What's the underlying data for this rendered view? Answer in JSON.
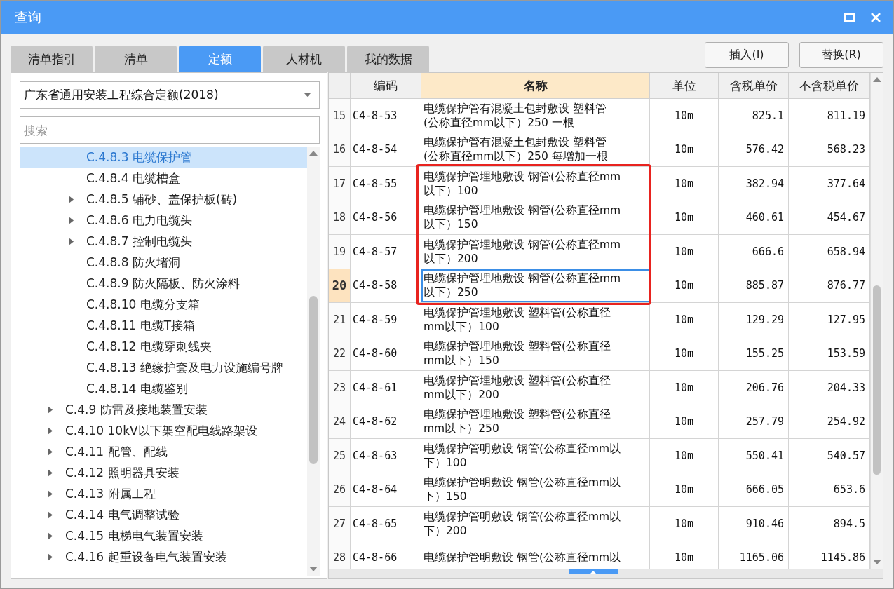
{
  "window": {
    "title": "查询"
  },
  "tabs": [
    {
      "label": "清单指引",
      "selected": false
    },
    {
      "label": "清单",
      "selected": false
    },
    {
      "label": "定额",
      "selected": true
    },
    {
      "label": "人材机",
      "selected": false
    },
    {
      "label": "我的数据",
      "selected": false
    }
  ],
  "buttons": [
    "插入(I)",
    "替换(R)"
  ],
  "library_select": {
    "value": "广东省通用安装工程综合定额(2018)"
  },
  "search": {
    "placeholder": "搜索"
  },
  "tree": {
    "items": [
      {
        "children": [
          {
            "label": "C.4.8.3 电缆保护管",
            "expandable": false,
            "selected": true
          },
          {
            "label": "C.4.8.4 电缆槽盒",
            "expandable": false,
            "selected": false
          },
          {
            "label": "C.4.8.5 铺砂、盖保护板(砖)",
            "expandable": true,
            "selected": false
          },
          {
            "label": "C.4.8.6 电力电缆头",
            "expandable": true,
            "selected": false
          },
          {
            "label": "C.4.8.7 控制电缆头",
            "expandable": true,
            "selected": false
          },
          {
            "label": "C.4.8.8 防火堵洞",
            "expandable": false,
            "selected": false
          },
          {
            "label": "C.4.8.9 防火隔板、防火涂料",
            "expandable": false,
            "selected": false
          },
          {
            "label": "C.4.8.10 电缆分支箱",
            "expandable": false,
            "selected": false
          },
          {
            "label": "C.4.8.11 电缆T接箱",
            "expandable": false,
            "selected": false
          },
          {
            "label": "C.4.8.12 电缆穿刺线夹",
            "expandable": false,
            "selected": false
          },
          {
            "label": "C.4.8.13 绝缘护套及电力设施编号牌",
            "expandable": false,
            "selected": false
          },
          {
            "label": "C.4.8.14 电缆鉴别",
            "expandable": false,
            "selected": false
          }
        ]
      },
      {
        "label": "C.4.9 防雷及接地装置安装",
        "expandable": true,
        "selected": false
      },
      {
        "label": "C.4.10 10kV以下架空配电线路架设",
        "expandable": true,
        "selected": false
      },
      {
        "label": "C.4.11 配管、配线",
        "expandable": true,
        "selected": false
      },
      {
        "label": "C.4.12 照明器具安装",
        "expandable": true,
        "selected": false
      },
      {
        "label": "C.4.13 附属工程",
        "expandable": true,
        "selected": false
      },
      {
        "label": "C.4.14 电气调整试验",
        "expandable": true,
        "selected": false
      },
      {
        "label": "C.4.15 电梯电气装置安装",
        "expandable": true,
        "selected": false
      },
      {
        "label": "C.4.16 起重设备电气装置安装",
        "expandable": true,
        "selected": false
      }
    ]
  },
  "table": {
    "columns": [
      {
        "label": "编码",
        "highlighted": false
      },
      {
        "label": "名称",
        "highlighted": true
      },
      {
        "label": "单位",
        "highlighted": false
      },
      {
        "label": "含税单价",
        "highlighted": false
      },
      {
        "label": "不含税单价",
        "highlighted": false
      }
    ],
    "rows": [
      {
        "no": "15",
        "code": "C4-8-53",
        "name": "电缆保护管有混凝土包封敷设 塑料管\n(公称直径mm以下）250 一根",
        "unit": "10m",
        "price_tax": "825.1",
        "price_no_tax": "811.19",
        "selected": false,
        "highlighted": false
      },
      {
        "no": "16",
        "code": "C4-8-54",
        "name": "电缆保护管有混凝土包封敷设 塑料管\n(公称直径mm以下）250 每增加一根",
        "unit": "10m",
        "price_tax": "576.42",
        "price_no_tax": "568.23",
        "selected": false,
        "highlighted": false
      },
      {
        "no": "17",
        "code": "C4-8-55",
        "name": "电缆保护管埋地敷设 钢管(公称直径mm\n以下）100",
        "unit": "10m",
        "price_tax": "382.94",
        "price_no_tax": "377.64",
        "selected": false,
        "highlighted": true
      },
      {
        "no": "18",
        "code": "C4-8-56",
        "name": "电缆保护管埋地敷设 钢管(公称直径mm\n以下）150",
        "unit": "10m",
        "price_tax": "460.61",
        "price_no_tax": "454.67",
        "selected": false,
        "highlighted": true
      },
      {
        "no": "19",
        "code": "C4-8-57",
        "name": "电缆保护管埋地敷设 钢管(公称直径mm\n以下）200",
        "unit": "10m",
        "price_tax": "666.6",
        "price_no_tax": "658.94",
        "selected": false,
        "highlighted": true
      },
      {
        "no": "20",
        "code": "C4-8-58",
        "name": "电缆保护管埋地敷设 钢管(公称直径mm\n以下）250",
        "unit": "10m",
        "price_tax": "885.87",
        "price_no_tax": "876.77",
        "selected": true,
        "highlighted": true
      },
      {
        "no": "21",
        "code": "C4-8-59",
        "name": "电缆保护管埋地敷设 塑料管(公称直径\nmm以下）100",
        "unit": "10m",
        "price_tax": "129.29",
        "price_no_tax": "127.95",
        "selected": false,
        "highlighted": false
      },
      {
        "no": "22",
        "code": "C4-8-60",
        "name": "电缆保护管埋地敷设 塑料管(公称直径\nmm以下）150",
        "unit": "10m",
        "price_tax": "155.25",
        "price_no_tax": "153.59",
        "selected": false,
        "highlighted": false
      },
      {
        "no": "23",
        "code": "C4-8-61",
        "name": "电缆保护管埋地敷设 塑料管(公称直径\nmm以下）200",
        "unit": "10m",
        "price_tax": "206.76",
        "price_no_tax": "204.33",
        "selected": false,
        "highlighted": false
      },
      {
        "no": "24",
        "code": "C4-8-62",
        "name": "电缆保护管埋地敷设 塑料管(公称直径\nmm以下）250",
        "unit": "10m",
        "price_tax": "257.79",
        "price_no_tax": "254.92",
        "selected": false,
        "highlighted": false
      },
      {
        "no": "25",
        "code": "C4-8-63",
        "name": "电缆保护管明敷设 钢管(公称直径mm以下）100",
        "unit": "10m",
        "price_tax": "550.41",
        "price_no_tax": "540.57",
        "selected": false,
        "highlighted": false
      },
      {
        "no": "26",
        "code": "C4-8-64",
        "name": "电缆保护管明敷设 钢管(公称直径mm以下）150",
        "unit": "10m",
        "price_tax": "666.05",
        "price_no_tax": "653.6",
        "selected": false,
        "highlighted": false
      },
      {
        "no": "27",
        "code": "C4-8-65",
        "name": "电缆保护管明敷设 钢管(公称直径mm以下）200",
        "unit": "10m",
        "price_tax": "910.46",
        "price_no_tax": "894.5",
        "selected": false,
        "highlighted": false
      },
      {
        "no": "28",
        "code": "C4-8-66",
        "name": "电缆保护管明敷设 钢管(公称直径mm以",
        "unit": "10m",
        "price_tax": "1165.06",
        "price_no_tax": "1145.86",
        "selected": false,
        "highlighted": false
      }
    ]
  }
}
